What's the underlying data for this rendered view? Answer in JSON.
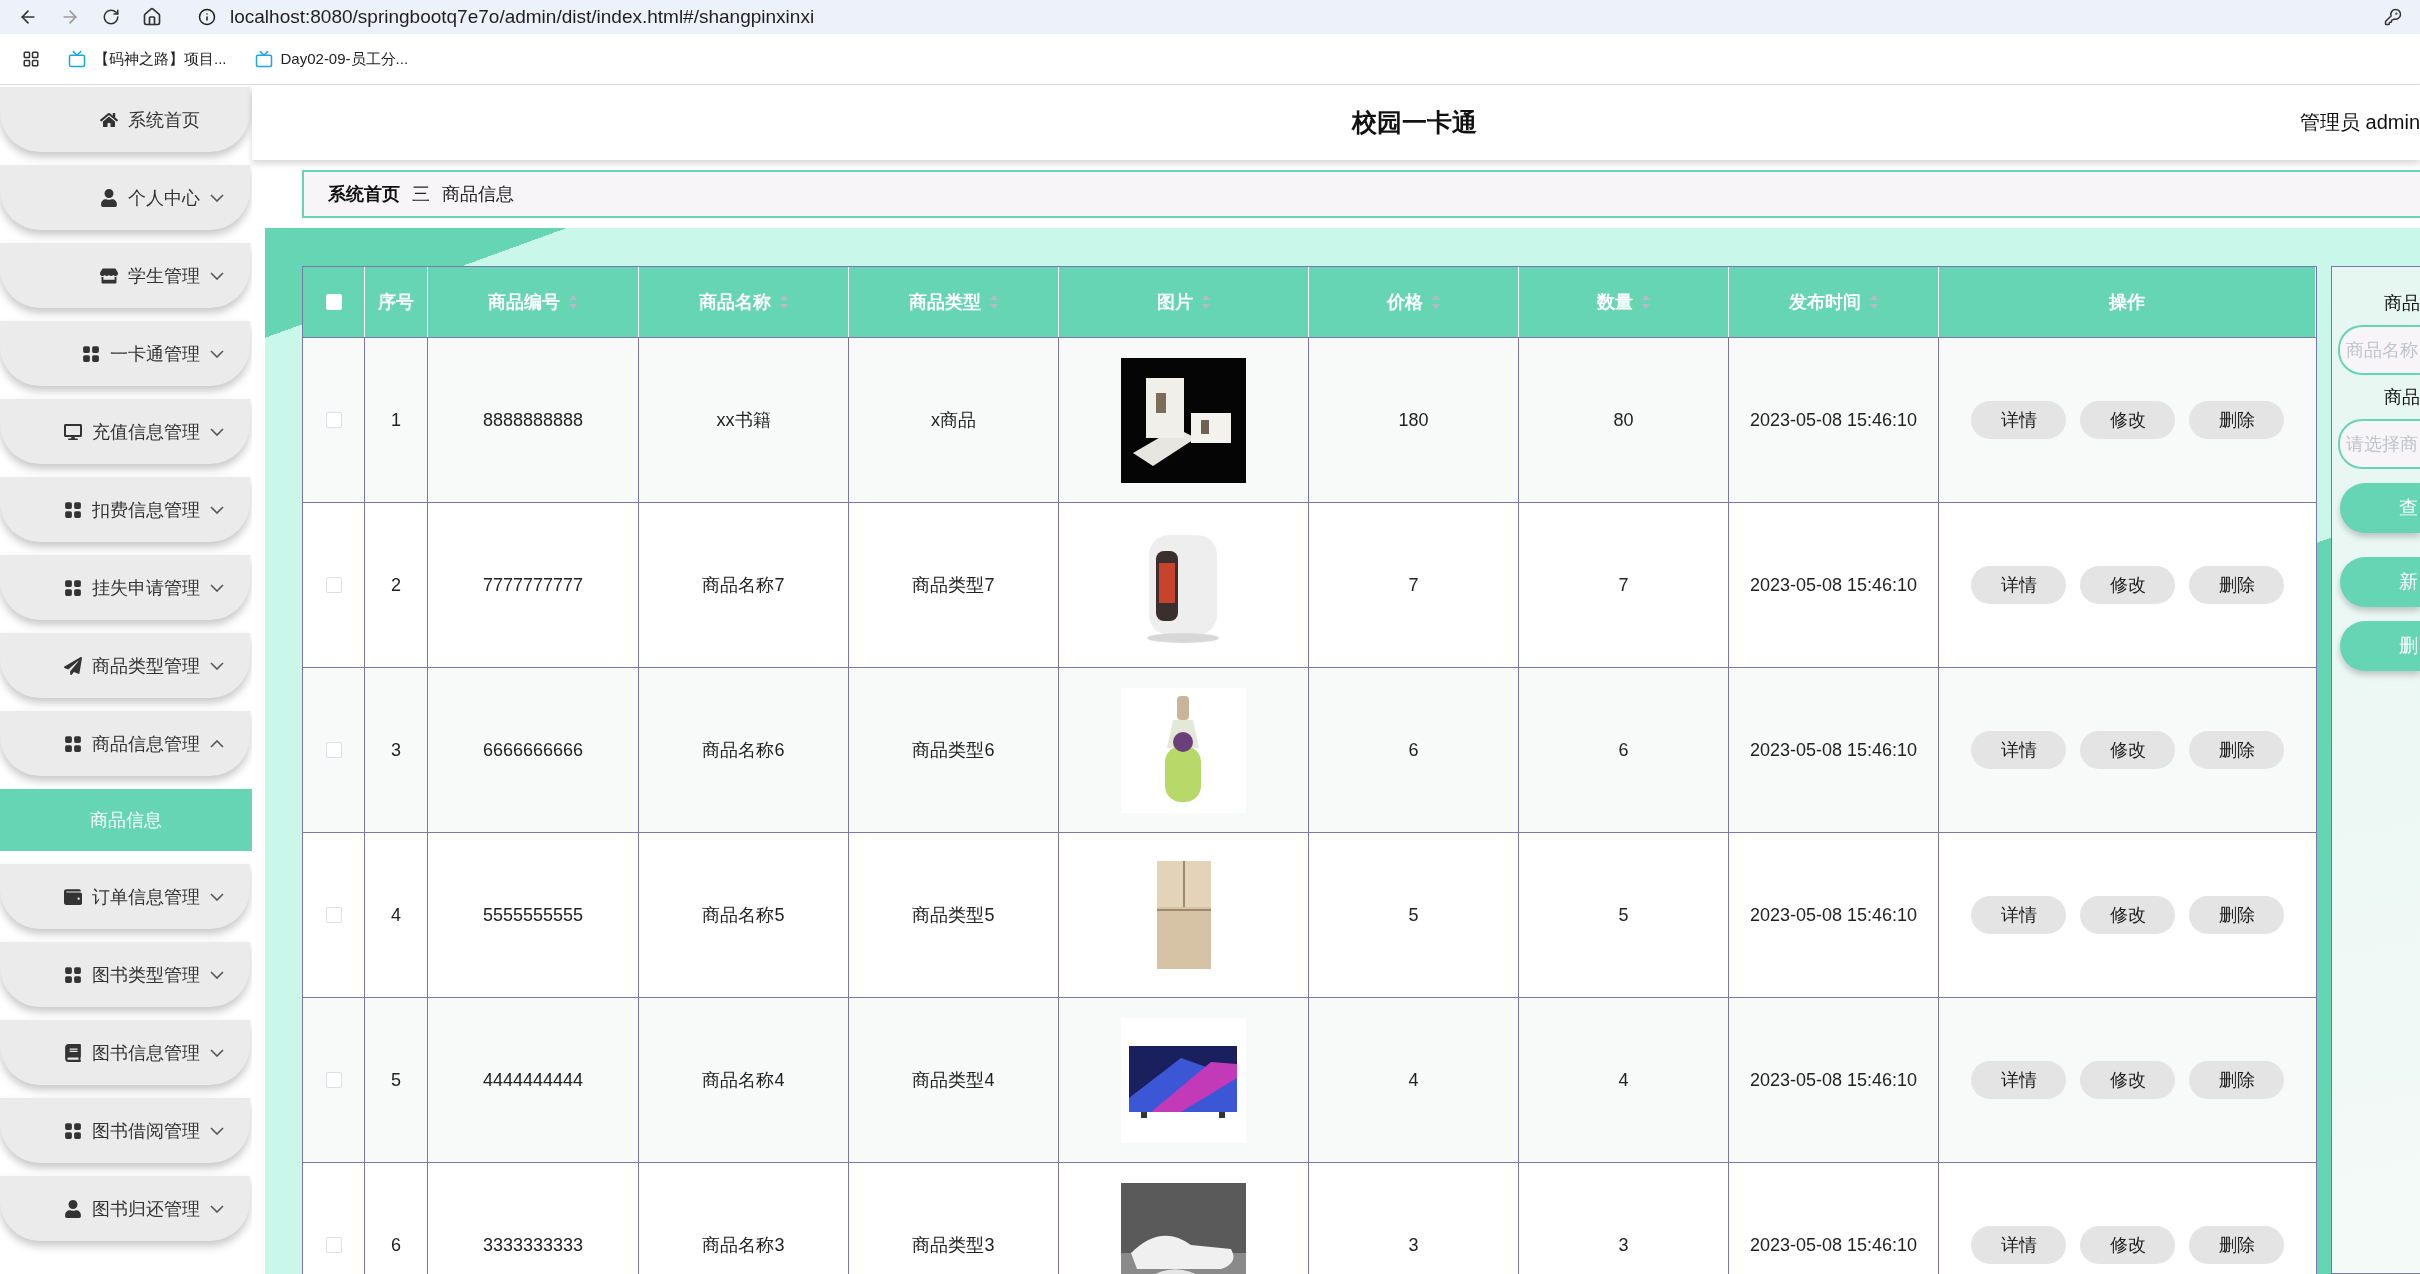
{
  "browser": {
    "url": "localhost:8080/springbootq7e7o/admin/dist/index.html#/shangpinxinxi",
    "bookmarks": [
      "【码神之路】项目...",
      "Day02-09-员工分..."
    ]
  },
  "header": {
    "title": "校园一卡通",
    "user": "管理员 admin"
  },
  "sidebar": {
    "items": [
      {
        "label": "系统首页",
        "kind": "home"
      },
      {
        "label": "个人中心",
        "kind": "user",
        "expanded": false
      },
      {
        "label": "学生管理",
        "kind": "store",
        "expanded": false
      },
      {
        "label": "一卡通管理",
        "kind": "grid",
        "expanded": false
      },
      {
        "label": "充值信息管理",
        "kind": "monitor",
        "expanded": false
      },
      {
        "label": "扣费信息管理",
        "kind": "grid",
        "expanded": false
      },
      {
        "label": "挂失申请管理",
        "kind": "grid",
        "expanded": false
      },
      {
        "label": "商品类型管理",
        "kind": "plane",
        "expanded": false
      },
      {
        "label": "商品信息管理",
        "kind": "grid",
        "expanded": true,
        "children": [
          {
            "label": "商品信息",
            "selected": true
          }
        ]
      },
      {
        "label": "订单信息管理",
        "kind": "wallet",
        "expanded": false
      },
      {
        "label": "图书类型管理",
        "kind": "grid",
        "expanded": false
      },
      {
        "label": "图书信息管理",
        "kind": "book",
        "expanded": false
      },
      {
        "label": "图书借阅管理",
        "kind": "grid",
        "expanded": false
      },
      {
        "label": "图书归还管理",
        "kind": "user",
        "expanded": false
      }
    ]
  },
  "breadcrumb": {
    "items": [
      "系统首页",
      "商品信息"
    ],
    "separator": "三"
  },
  "table": {
    "select_all_checked": false,
    "columns": [
      {
        "label": "序号",
        "sortable": false
      },
      {
        "label": "商品编号",
        "sortable": true
      },
      {
        "label": "商品名称",
        "sortable": true
      },
      {
        "label": "商品类型",
        "sortable": true
      },
      {
        "label": "图片",
        "sortable": true
      },
      {
        "label": "价格",
        "sortable": true
      },
      {
        "label": "数量",
        "sortable": true
      },
      {
        "label": "发布时间",
        "sortable": true
      },
      {
        "label": "操作",
        "sortable": false
      }
    ],
    "rows": [
      {
        "checked": false,
        "index": "1",
        "code": "8888888888",
        "name": "xx书籍",
        "type": "x商品",
        "price": "180",
        "quantity": "80",
        "time": "2023-05-08 15:46:10",
        "actions": [
          "详情",
          "修改",
          "删除"
        ]
      },
      {
        "checked": false,
        "index": "2",
        "code": "7777777777",
        "name": "商品名称7",
        "type": "商品类型7",
        "price": "7",
        "quantity": "7",
        "time": "2023-05-08 15:46:10",
        "actions": [
          "详情",
          "修改",
          "删除"
        ]
      },
      {
        "checked": false,
        "index": "3",
        "code": "6666666666",
        "name": "商品名称6",
        "type": "商品类型6",
        "price": "6",
        "quantity": "6",
        "time": "2023-05-08 15:46:10",
        "actions": [
          "详情",
          "修改",
          "删除"
        ]
      },
      {
        "checked": false,
        "index": "4",
        "code": "5555555555",
        "name": "商品名称5",
        "type": "商品类型5",
        "price": "5",
        "quantity": "5",
        "time": "2023-05-08 15:46:10",
        "actions": [
          "详情",
          "修改",
          "删除"
        ]
      },
      {
        "checked": false,
        "index": "5",
        "code": "4444444444",
        "name": "商品名称4",
        "type": "商品类型4",
        "price": "4",
        "quantity": "4",
        "time": "2023-05-08 15:46:10",
        "actions": [
          "详情",
          "修改",
          "删除"
        ]
      },
      {
        "checked": false,
        "index": "6",
        "code": "3333333333",
        "name": "商品名称3",
        "type": "商品类型3",
        "price": "3",
        "quantity": "3",
        "time": "2023-05-08 15:46:10",
        "actions": [
          "详情",
          "修改",
          "删除"
        ]
      }
    ]
  },
  "search_panel": {
    "fields": [
      {
        "label": "商品",
        "placeholder": "商品名称"
      },
      {
        "label": "商品",
        "placeholder": "请选择商"
      }
    ],
    "buttons": [
      "查",
      "新",
      "删"
    ]
  }
}
